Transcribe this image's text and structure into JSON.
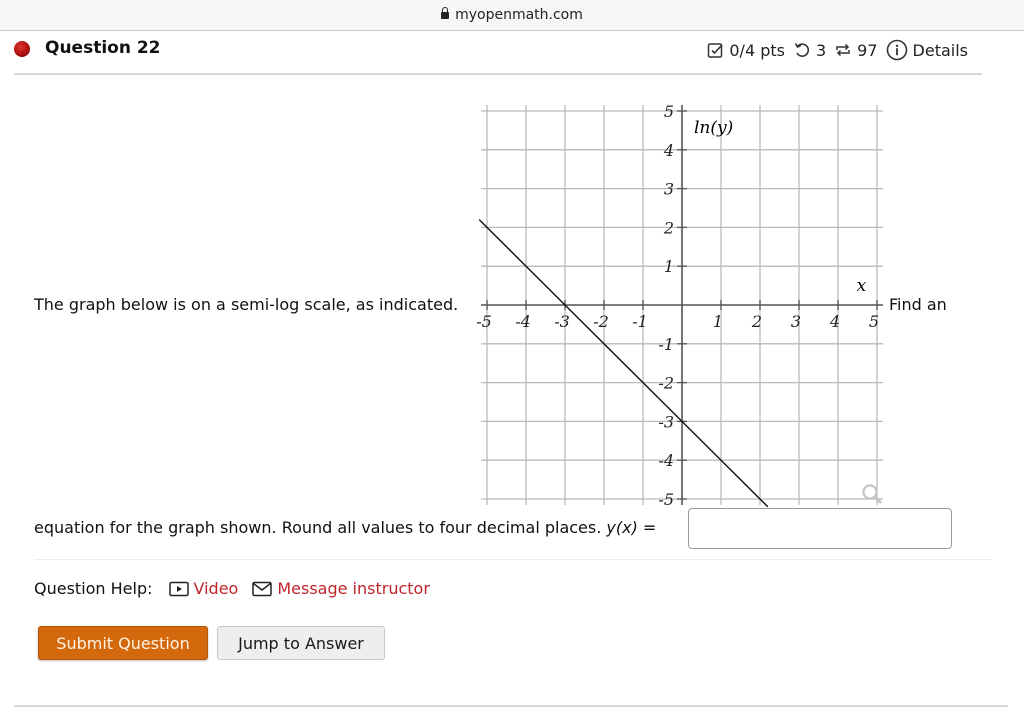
{
  "browser": {
    "url": "myopenmath.com"
  },
  "question": {
    "title": "Question 22",
    "status_color": "#b01010",
    "meta": {
      "score": "0/4 pts",
      "retries": "3",
      "attempts": "97",
      "details_label": "Details"
    },
    "prompt_part1": "The graph below is on a semi-log scale, as indicated.",
    "prompt_part2": "Find an",
    "prompt_part3": "equation for the graph shown. Round all values to four decimal places.",
    "answer_label": "y(x) =",
    "answer_value": "",
    "answer_placeholder": ""
  },
  "help": {
    "label": "Question Help:",
    "video_label": "Video",
    "message_label": "Message instructor",
    "link_color": "#c0242b"
  },
  "buttons": {
    "submit_label": "Submit Question",
    "jump_label": "Jump to Answer",
    "submit_color": "#d4680d"
  },
  "chart_data": {
    "type": "line",
    "title": "",
    "xlabel": "x",
    "ylabel": "ln(y)",
    "xlim": [
      -5,
      5
    ],
    "ylim": [
      -5,
      5
    ],
    "grid": true,
    "x_ticks": [
      -5,
      -4,
      -3,
      -2,
      -1,
      1,
      2,
      3,
      4,
      5
    ],
    "y_ticks": [
      -5,
      -4,
      -3,
      -2,
      -1,
      1,
      2,
      3,
      4,
      5
    ],
    "x_tick_labels": [
      "-5",
      "-4",
      "-3",
      "-2",
      "-1",
      "1",
      "2",
      "3",
      "4",
      "5"
    ],
    "y_tick_labels": [
      "-5",
      "-4",
      "-3",
      "-2",
      "-1",
      "1",
      "2",
      "3",
      "4",
      "5"
    ],
    "series": [
      {
        "name": "ln(y)",
        "x": [
          -5.2,
          2.2
        ],
        "y": [
          2.2,
          -5.2
        ],
        "slope": -1,
        "intercept": -3
      }
    ],
    "key_points": [
      {
        "x": -3,
        "y": 0
      },
      {
        "x": 0,
        "y": -3
      },
      {
        "x": -4,
        "y": 1
      },
      {
        "x": 1,
        "y": -4
      }
    ]
  }
}
